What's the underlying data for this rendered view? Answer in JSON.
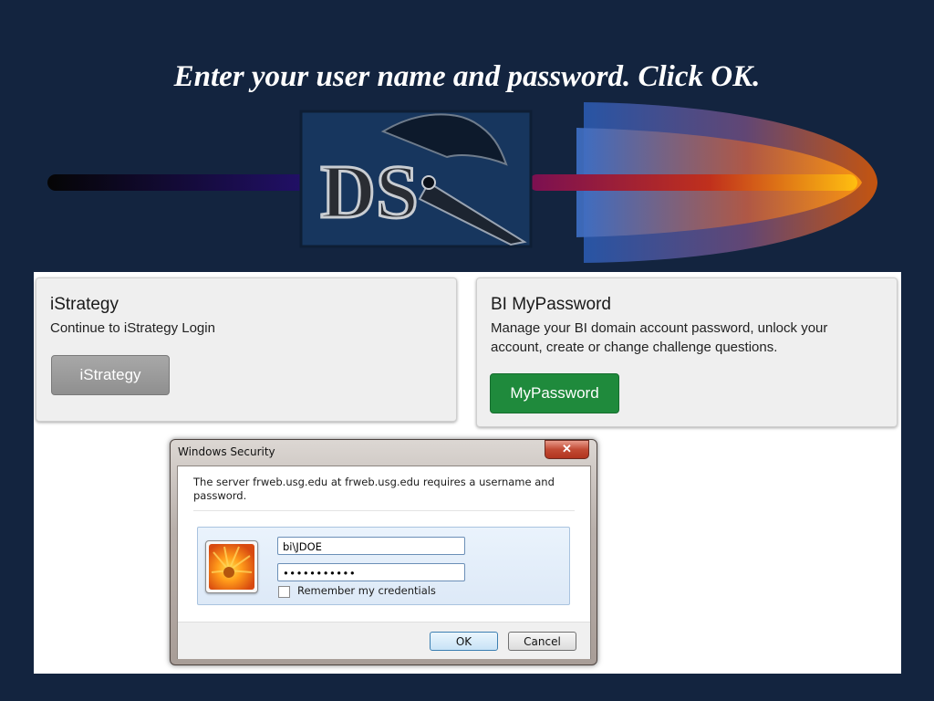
{
  "slide": {
    "title": "Enter your user name and password. Click OK."
  },
  "istrategy_panel": {
    "title": "iStrategy",
    "description": "Continue to iStrategy Login",
    "button_label": "iStrategy"
  },
  "mypassword_panel": {
    "title": "BI MyPassword",
    "description": "Manage your BI domain account password, unlock your account, create or change challenge questions.",
    "button_label": "MyPassword"
  },
  "security_dialog": {
    "title": "Windows Security",
    "close_glyph": "✕",
    "message": "The server frweb.usg.edu at frweb.usg.edu requires a username and password.",
    "username_value": "bi\\JDOE",
    "password_value": "•••••••••••",
    "remember_label": "Remember my credentials",
    "remember_checked": false,
    "ok_label": "OK",
    "cancel_label": "Cancel"
  },
  "colors": {
    "slide_background": "#13243f",
    "mypassword_button": "#1f8a3c",
    "istrategy_button": "#999999",
    "dialog_close": "#c24a34"
  },
  "icons": {
    "logo": "ds-roadrunner-logo-icon",
    "credential_tile": "flower-user-tile-icon"
  }
}
